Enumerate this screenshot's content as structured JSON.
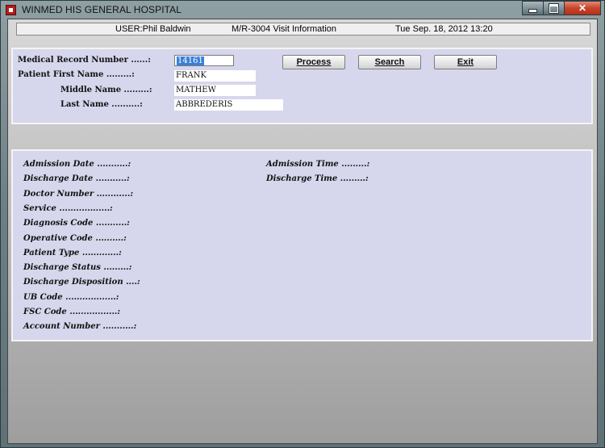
{
  "window": {
    "title": "WINMED HIS GENERAL HOSPITAL"
  },
  "infobar": {
    "user": "USER:Phil Baldwin",
    "screen": "M/R-3004  Visit Information",
    "datetime": "Tue Sep. 18, 2012 13:20"
  },
  "search_form": {
    "mrn_label": "Medical Record Number ......:",
    "mrn_value": "14161",
    "first_label": "Patient First Name .........:",
    "first_value": "FRANK",
    "middle_label": "Middle Name .........:",
    "middle_value": "MATHEW",
    "last_label": "Last Name ..........:",
    "last_value": "ABBREDERIS"
  },
  "buttons": {
    "process": "Process",
    "search": "Search",
    "exit": "Exit"
  },
  "visit_fields": {
    "admission_date": "Admission Date ...........:",
    "discharge_date": "Discharge Date ...........:",
    "doctor_number": "Doctor Number ............:",
    "service": "Service ..................:",
    "diagnosis_code": "Diagnosis Code ...........:",
    "operative_code": "Operative Code ..........:",
    "patient_type": "Patient Type .............:",
    "discharge_status": "Discharge Status .........:",
    "discharge_disposition": "Discharge Disposition ....:",
    "ub_code": "UB Code ..................:",
    "fsc_code": "FSC Code .................:",
    "account_number": "Account Number ...........:",
    "admission_time": "Admission Time .........:",
    "discharge_time": "Discharge Time .........:"
  }
}
